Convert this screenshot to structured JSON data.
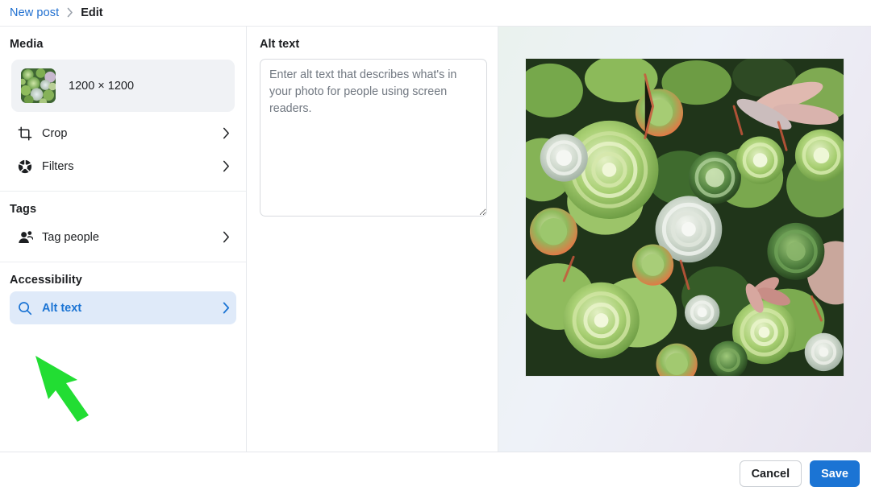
{
  "breadcrumb": {
    "parent": "New post",
    "separator": "›",
    "current": "Edit"
  },
  "sidebar": {
    "sections": [
      {
        "title": "Media",
        "media_card": {
          "dimensions": "1200 × 1200",
          "thumbnail_icon": "succulents-thumbnail"
        },
        "rows": [
          {
            "label": "Crop",
            "icon": "crop-icon",
            "chevron": "chevron-right-icon",
            "active": false
          },
          {
            "label": "Filters",
            "icon": "aperture-icon",
            "chevron": "chevron-right-icon",
            "active": false
          }
        ]
      },
      {
        "title": "Tags",
        "rows": [
          {
            "label": "Tag people",
            "icon": "tag-people-icon",
            "chevron": "chevron-right-icon",
            "active": false
          }
        ]
      },
      {
        "title": "Accessibility",
        "rows": [
          {
            "label": "Alt text",
            "icon": "search-icon",
            "chevron": "chevron-right-icon",
            "active": true
          }
        ]
      }
    ]
  },
  "main": {
    "title": "Alt text",
    "alt_text": {
      "value": "",
      "placeholder": "Enter alt text that describes what's in your photo for people using screen readers."
    }
  },
  "preview": {
    "image_label": "succulent-garden-photo"
  },
  "footer": {
    "cancel_label": "Cancel",
    "save_label": "Save"
  },
  "annotation": {
    "arrow_color": "#22dd33",
    "points_to": "Alt text"
  },
  "colors": {
    "accent": "#1b74d4",
    "link": "#1f6fd0",
    "active_row_bg": "#dfeaf9",
    "media_card_bg": "#f0f2f5",
    "text": "#1c1e21",
    "placeholder": "#707780",
    "annotation_green": "#22dd33"
  }
}
